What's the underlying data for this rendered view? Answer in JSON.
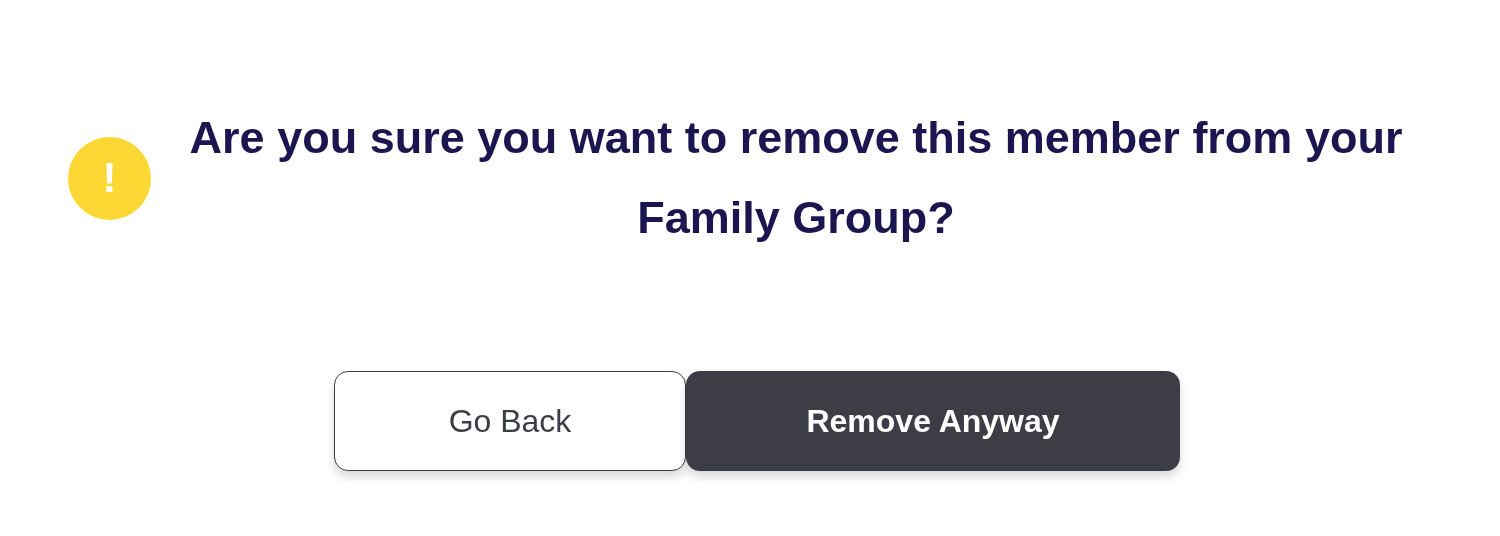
{
  "dialog": {
    "icon_text": "!",
    "message": "Are you sure you want to remove this member from your Family Group?",
    "buttons": [
      {
        "label": "Go Back",
        "kind": "secondary"
      },
      {
        "label": "Remove Anyway",
        "kind": "primary"
      }
    ]
  }
}
